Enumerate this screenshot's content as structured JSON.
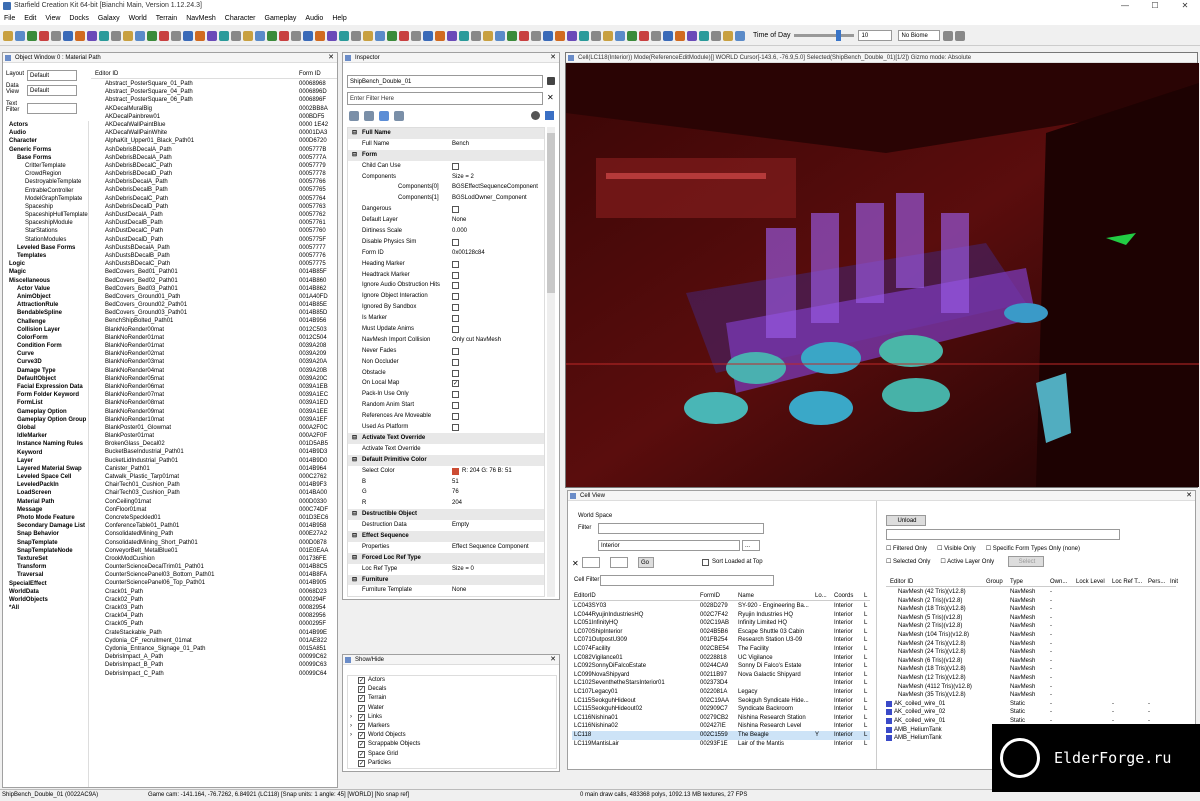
{
  "window_title": "Starfield Creation Kit 64-bit [Bianchi Main, Version 1.12.24.3]",
  "menu": [
    "File",
    "Edit",
    "View",
    "Docks",
    "Galaxy",
    "World",
    "Terrain",
    "NavMesh",
    "Character",
    "Gameplay",
    "Audio",
    "Help"
  ],
  "toolbar": {
    "time_of_day_label": "Time of Day",
    "time_value": "10",
    "biome_value": "No Biome"
  },
  "object_window": {
    "title": "Object Window 0 : Material Path",
    "layout_label": "Layout",
    "layout_value": "Default",
    "data_view_label": "Data View",
    "data_view_value": "Default",
    "text_filter_label": "Text Filter",
    "col_editor_id": "Editor ID",
    "col_form_id": "Form ID",
    "tree": [
      {
        "t": "Actors",
        "d": 0,
        "b": true
      },
      {
        "t": "Audio",
        "d": 0,
        "b": true
      },
      {
        "t": "Character",
        "d": 0,
        "b": true
      },
      {
        "t": "Generic Forms",
        "d": 0,
        "b": true
      },
      {
        "t": "Base Forms",
        "d": 1,
        "b": true
      },
      {
        "t": "CritterTemplate",
        "d": 2
      },
      {
        "t": "CrowdRegion",
        "d": 2
      },
      {
        "t": "DestroyableTemplate",
        "d": 2
      },
      {
        "t": "EntrableController",
        "d": 2
      },
      {
        "t": "ModelGraphTemplate",
        "d": 2
      },
      {
        "t": "Spaceship",
        "d": 2
      },
      {
        "t": "SpaceshipHullTemplate",
        "d": 2
      },
      {
        "t": "SpaceshipModule",
        "d": 2
      },
      {
        "t": "StarStations",
        "d": 2
      },
      {
        "t": "StationModules",
        "d": 2
      },
      {
        "t": "Leveled Base Forms",
        "d": 1,
        "b": true
      },
      {
        "t": "Templates",
        "d": 1,
        "b": true
      },
      {
        "t": "Logic",
        "d": 0,
        "b": true
      },
      {
        "t": "Magic",
        "d": 0,
        "b": true
      },
      {
        "t": "Miscellaneous",
        "d": 0,
        "b": true
      },
      {
        "t": "Actor Value",
        "d": 1,
        "b": true
      },
      {
        "t": "AnimObject",
        "d": 1,
        "b": true
      },
      {
        "t": "AttractionRule",
        "d": 1,
        "b": true
      },
      {
        "t": "BendableSpline",
        "d": 1,
        "b": true
      },
      {
        "t": "Challenge",
        "d": 1,
        "b": true
      },
      {
        "t": "Collision Layer",
        "d": 1,
        "b": true
      },
      {
        "t": "ColorForm",
        "d": 1,
        "b": true
      },
      {
        "t": "Condition Form",
        "d": 1,
        "b": true
      },
      {
        "t": "Curve",
        "d": 1,
        "b": true
      },
      {
        "t": "Curve3D",
        "d": 1,
        "b": true
      },
      {
        "t": "Damage Type",
        "d": 1,
        "b": true
      },
      {
        "t": "DefaultObject",
        "d": 1,
        "b": true
      },
      {
        "t": "Facial Expression Data",
        "d": 1,
        "b": true
      },
      {
        "t": "Form Folder Keyword",
        "d": 1,
        "b": true
      },
      {
        "t": "FormList",
        "d": 1,
        "b": true
      },
      {
        "t": "Gameplay Option",
        "d": 1,
        "b": true
      },
      {
        "t": "Gameplay Option Group",
        "d": 1,
        "b": true
      },
      {
        "t": "Global",
        "d": 1,
        "b": true
      },
      {
        "t": "IdleMarker",
        "d": 1,
        "b": true
      },
      {
        "t": "Instance Naming Rules",
        "d": 1,
        "b": true
      },
      {
        "t": "Keyword",
        "d": 1,
        "b": true
      },
      {
        "t": "Layer",
        "d": 1,
        "b": true
      },
      {
        "t": "Layered Material Swap",
        "d": 1,
        "b": true
      },
      {
        "t": "Leveled Space Cell",
        "d": 1,
        "b": true
      },
      {
        "t": "LeveledPackIn",
        "d": 1,
        "b": true
      },
      {
        "t": "LoadScreen",
        "d": 1,
        "b": true
      },
      {
        "t": "Material Path",
        "d": 1,
        "b": true
      },
      {
        "t": "Message",
        "d": 1,
        "b": true
      },
      {
        "t": "Photo Mode Feature",
        "d": 1,
        "b": true
      },
      {
        "t": "Secondary Damage List",
        "d": 1,
        "b": true
      },
      {
        "t": "Snap Behavior",
        "d": 1,
        "b": true
      },
      {
        "t": "SnapTemplate",
        "d": 1,
        "b": true
      },
      {
        "t": "SnapTemplateNode",
        "d": 1,
        "b": true
      },
      {
        "t": "TextureSet",
        "d": 1,
        "b": true
      },
      {
        "t": "Transform",
        "d": 1,
        "b": true
      },
      {
        "t": "Traversal",
        "d": 1,
        "b": true
      },
      {
        "t": "SpecialEffect",
        "d": 0,
        "b": true
      },
      {
        "t": "WorldData",
        "d": 0,
        "b": true
      },
      {
        "t": "WorldObjects",
        "d": 0,
        "b": true
      },
      {
        "t": "*All",
        "d": 0,
        "b": true
      }
    ],
    "items": [
      [
        "Abstract_PosterSquare_01_Path",
        "00068968"
      ],
      [
        "Abstract_PosterSquare_04_Path",
        "0006896D"
      ],
      [
        "Abstract_PosterSquare_06_Path",
        "0006896F"
      ],
      [
        "AKDecalMuralBig",
        "0002BB8A"
      ],
      [
        "AKDecalPainbrew01",
        "000BDF5"
      ],
      [
        "AKDecalWallPaintBlue",
        "0000 1E42"
      ],
      [
        "AKDecalWallPainWhite",
        "00001DA3"
      ],
      [
        "AlphaKit_Upper01_Black_Path01",
        "000D6720"
      ],
      [
        "AshDebrisBDecalA_Path",
        "0005777B"
      ],
      [
        "AshDebrisBDecalA_Path",
        "0005777A"
      ],
      [
        "AshDebrisBDecalC_Path",
        "00057779"
      ],
      [
        "AshDebrisBDecalD_Path",
        "00057778"
      ],
      [
        "AshDebrisDecalA_Path",
        "00057766"
      ],
      [
        "AshDebrisDecalB_Path",
        "00057765"
      ],
      [
        "AshDebrisDecalC_Path",
        "00057764"
      ],
      [
        "AshDebrisDecalD_Path",
        "00057763"
      ],
      [
        "AshDustDecalA_Path",
        "00057762"
      ],
      [
        "AshDustDecalB_Path",
        "00057761"
      ],
      [
        "AshDustDecalC_Path",
        "00057760"
      ],
      [
        "AshDustDecalD_Path",
        "0005775F"
      ],
      [
        "AshDustsBDecalA_Path",
        "00057777"
      ],
      [
        "AshDustsBDecalB_Path",
        "00057776"
      ],
      [
        "AshDustsBDecalC_Path",
        "00057775"
      ],
      [
        "BedCovers_Bed01_Path01",
        "0014B85F"
      ],
      [
        "BedCovers_Bed02_Path01",
        "0014B860"
      ],
      [
        "BedCovers_Bed03_Path01",
        "0014B862"
      ],
      [
        "BedCovers_Ground01_Path",
        "001A40FD"
      ],
      [
        "BedCovers_Ground02_Path01",
        "0014B85E"
      ],
      [
        "BedCovers_Ground03_Path01",
        "0014B85D"
      ],
      [
        "BenchShipBolted_Path01",
        "0014B956"
      ],
      [
        "BlankNoRender00mat",
        "0012C503"
      ],
      [
        "BlankNoRender01mat",
        "0012C504"
      ],
      [
        "BlankNoRender01mat",
        "0039A208"
      ],
      [
        "BlankNoRender02mat",
        "0039A209"
      ],
      [
        "BlankNoRender03mat",
        "0039A20A"
      ],
      [
        "BlankNoRender04mat",
        "0039A20B"
      ],
      [
        "BlankNoRender05mat",
        "0039A20C"
      ],
      [
        "BlankNoRender06mat",
        "0039A1EB"
      ],
      [
        "BlankNoRender07mat",
        "0039A1EC"
      ],
      [
        "BlankNoRender08mat",
        "0039A1ED"
      ],
      [
        "BlankNoRender09mat",
        "0039A1EE"
      ],
      [
        "BlankNoRender10mat",
        "0039A1EF"
      ],
      [
        "BlankPoster01_Glowmat",
        "000A2F0C"
      ],
      [
        "BlankPoster01mat",
        "000A2F0F"
      ],
      [
        "BrokenGlass_Decal02",
        "001D5AB5"
      ],
      [
        "BucketBaseIndustrial_Path01",
        "0014B9D3"
      ],
      [
        "BucketLidIndustrial_Path01",
        "0014B9D0"
      ],
      [
        "Canister_Path01",
        "0014B964"
      ],
      [
        "Catwalk_Plastic_Tarp01mat",
        "000C2762"
      ],
      [
        "ChairTech01_Cushion_Path",
        "0014B9F3"
      ],
      [
        "ChairTech03_Cushion_Path",
        "0014BA00"
      ],
      [
        "ConCeiling01mat",
        "000D0330"
      ],
      [
        "ConFloor01mat",
        "000C74DF"
      ],
      [
        "ConcreteSpeckled01",
        "001D3EC6"
      ],
      [
        "ConferenceTable01_Path01",
        "0014B958"
      ],
      [
        "ConsolidatedMining_Path",
        "000E27A2"
      ],
      [
        "ConsolidatedMining_Short_Path01",
        "000D0878"
      ],
      [
        "ConveyorBelt_MetalBlue01",
        "001E0EAA"
      ],
      [
        "CrookModCushion",
        "001736FE"
      ],
      [
        "CounterScienceDecalTrim01_Path01",
        "0014B8C5"
      ],
      [
        "CounterSciencePanel03_Bottom_Path01",
        "0014B8FA"
      ],
      [
        "CounterSciencePanel06_Top_Path01",
        "0014B905"
      ],
      [
        "Crack01_Path",
        "00068D23"
      ],
      [
        "Crack02_Path",
        "0000294F"
      ],
      [
        "Crack03_Path",
        "00082954"
      ],
      [
        "Crack04_Path",
        "00082956"
      ],
      [
        "Crack05_Path",
        "0000295F"
      ],
      [
        "CrateStackable_Path",
        "0014B99E"
      ],
      [
        "Cydonia_CF_recruitment_01mat",
        "001AE822"
      ],
      [
        "Cydonia_Entrance_Signage_01_Path",
        "0015A851"
      ],
      [
        "DebrisImpact_A_Path",
        "00099C62"
      ],
      [
        "DebrisImpact_B_Path",
        "00099C63"
      ],
      [
        "DebrisImpact_C_Path",
        "00099C64"
      ]
    ]
  },
  "inspector": {
    "title": "Inspector",
    "name_value": "ShipBench_Double_01",
    "filter_placeholder": "Enter Filter Here",
    "rows": [
      {
        "s": true,
        "k": "Full Name"
      },
      {
        "k": "Full Name",
        "v": "Bench"
      },
      {
        "s": true,
        "k": "Form"
      },
      {
        "k": "Child Can Use",
        "cb": "off"
      },
      {
        "k": "Components",
        "v": "Size = 2"
      },
      {
        "k": "Components[0]",
        "v": "BGSEffectSequenceComponent",
        "ind": true
      },
      {
        "k": "Components[1]",
        "v": "BGSLodOwner_Component",
        "ind": true
      },
      {
        "k": "Dangerous",
        "cb": "off"
      },
      {
        "k": "Default Layer",
        "v": "None"
      },
      {
        "k": "Dirtiness Scale",
        "v": "0.000"
      },
      {
        "k": "Disable Physics Sim",
        "cb": "off"
      },
      {
        "k": "Form ID",
        "v": "0x00128c84"
      },
      {
        "k": "Heading Marker",
        "cb": "off"
      },
      {
        "k": "Headtrack Marker",
        "cb": "off"
      },
      {
        "k": "Ignore Audio Obstruction Hits",
        "cb": "off"
      },
      {
        "k": "Ignore Object Interaction",
        "cb": "off"
      },
      {
        "k": "Ignored By Sandbox",
        "cb": "off"
      },
      {
        "k": "Is Marker",
        "cb": "off"
      },
      {
        "k": "Must Update Anims",
        "cb": "off"
      },
      {
        "k": "NavMesh Import Collision",
        "v": "Only cut NavMesh"
      },
      {
        "k": "Never Fades",
        "cb": "off"
      },
      {
        "k": "Non Occluder",
        "cb": "off"
      },
      {
        "k": "Obstacle",
        "cb": "off"
      },
      {
        "k": "On Local Map",
        "cb": "on"
      },
      {
        "k": "Pack-In Use Only",
        "cb": "off"
      },
      {
        "k": "Random Anim Start",
        "cb": "off"
      },
      {
        "k": "References Are Moveable",
        "cb": "off"
      },
      {
        "k": "Used As Platform",
        "cb": "off"
      },
      {
        "s": true,
        "k": "Activate Text Override"
      },
      {
        "k": "Activate Text Override"
      },
      {
        "s": true,
        "k": "Default Primitive Color"
      },
      {
        "k": "Select Color",
        "v": "R: 204 G: 76 B: 51",
        "sw": true
      },
      {
        "k": "B",
        "v": "51"
      },
      {
        "k": "G",
        "v": "76"
      },
      {
        "k": "R",
        "v": "204"
      },
      {
        "s": true,
        "k": "Destructible Object"
      },
      {
        "k": "Destruction Data",
        "v": "Empty"
      },
      {
        "s": true,
        "k": "Effect Sequence"
      },
      {
        "k": "Properties",
        "v": "Effect Sequence Component"
      },
      {
        "s": true,
        "k": "Forced Loc Ref Type"
      },
      {
        "k": "Loc Ref Type",
        "v": "Size = 0"
      },
      {
        "s": true,
        "k": "Furniture"
      },
      {
        "k": "Furniture Template",
        "v": "None"
      }
    ],
    "swatch_color": "#cc4c33"
  },
  "show_hide": {
    "title": "Show/Hide",
    "items": [
      {
        "t": "Actors",
        "e": false
      },
      {
        "t": "Decals",
        "e": false
      },
      {
        "t": "Terrain",
        "e": false
      },
      {
        "t": "Water",
        "e": false
      },
      {
        "t": "Links",
        "e": true
      },
      {
        "t": "Markers",
        "e": true
      },
      {
        "t": "World Objects",
        "e": true
      },
      {
        "t": "Scrappable Objects",
        "e": false
      },
      {
        "t": "Space Grid",
        "e": false
      },
      {
        "t": "Particles",
        "e": false
      }
    ]
  },
  "viewport": {
    "title": "Cell(LC118(Interior)) Mode(ReferenceEditModule)[] WORLD  Cursor[-143.6, -76.9,5.0]  Selected(ShipBench_Double_01)[1/2]) Gizmo mode: Absolute"
  },
  "cell_view": {
    "title": "Cell View",
    "world_space_label": "World Space",
    "filter_label": "Filter",
    "interior_value": "Interior",
    "go_label": "Go",
    "sort_label": "Sort Loaded at Top",
    "cell_filter_label": "Cell Filter",
    "cols": [
      "EditorID",
      "FormID",
      "Name",
      "Lo...",
      "Coords",
      "L"
    ],
    "rows": [
      [
        "LC043SY03",
        "0028D279",
        "SY-920 - Engineering Ba...",
        "",
        "Interior",
        "L"
      ],
      [
        "LC044RyujinIndustriesHQ",
        "002C7F42",
        "Ryujin Industries HQ",
        "",
        "Interior",
        "L"
      ],
      [
        "LC051InfinityHQ",
        "002C19AB",
        "Infinity Limited HQ",
        "",
        "Interior",
        "L"
      ],
      [
        "LC070ShipInterior",
        "0024B5B6",
        "Escape Shuttle 03 Cabin",
        "",
        "Interior",
        "L"
      ],
      [
        "LC071OutpostU309",
        "001FB254",
        "Research Station U3-09",
        "",
        "Interior",
        "L"
      ],
      [
        "LC074Facility",
        "002CBE54",
        "The Facility",
        "",
        "Interior",
        "L"
      ],
      [
        "LC082Vigilance01",
        "00228818",
        "UC Vigilance",
        "",
        "Interior",
        "L"
      ],
      [
        "LC092SonnyDiFalcoEstate",
        "00244CA9",
        "Sonny Di Falco's Estate",
        "",
        "Interior",
        "L"
      ],
      [
        "LC099NovaShipyard",
        "00211B97",
        "Nova Galactic Shipyard",
        "",
        "Interior",
        "L"
      ],
      [
        "LC102SeventhetheStarsInterior01",
        "002373D4",
        "",
        "",
        "Interior",
        "L"
      ],
      [
        "LC107Legacy01",
        "0022081A",
        "Legacy",
        "",
        "Interior",
        "L"
      ],
      [
        "LC115SeokguhHideout",
        "002C19AA",
        "Seokguh Syndicate Hide...",
        "",
        "Interior",
        "L"
      ],
      [
        "LC115SeokguhHideout02",
        "002909C7",
        "Syndicate Backroom",
        "",
        "Interior",
        "L"
      ],
      [
        "LC116Nishina01",
        "00279CB2",
        "Nishina Research Station",
        "",
        "Interior",
        "L"
      ],
      [
        "LC116Nishina02",
        "002427IE",
        "Nishina Research Level",
        "",
        "Interior",
        "L"
      ],
      [
        "LC118",
        "002C1559",
        "The Beagle",
        "Y",
        "Interior",
        "L"
      ],
      [
        "LC119MantisLair",
        "00293F1E",
        "Lair of the Mantis",
        "",
        "Interior",
        "L"
      ]
    ],
    "unload_label": "Unload",
    "filtered_only": "Filtered Only",
    "visible_only": "Visible Only",
    "specific_form": "Specific Form Types Only (none)",
    "selected_only": "Selected Only",
    "active_layer_only": "Active Layer Only",
    "select_label": "Select",
    "ref_cols": [
      "Editor ID",
      "Group",
      "Type",
      "Own...",
      "Lock Level",
      "Loc Ref T...",
      "Pers...",
      "Init"
    ],
    "refs": [
      [
        "NavMesh (42 Tris)(v12.8)",
        "",
        "NavMesh",
        "-"
      ],
      [
        "NavMesh (2 Tris)(v12.8)",
        "",
        "NavMesh",
        "-"
      ],
      [
        "NavMesh (18 Tris)(v12.8)",
        "",
        "NavMesh",
        "-"
      ],
      [
        "NavMesh (5 Tris)(v12.8)",
        "",
        "NavMesh",
        "-"
      ],
      [
        "NavMesh (2 Tris)(v12.8)",
        "",
        "NavMesh",
        "-"
      ],
      [
        "NavMesh (104 Tris)(v12.8)",
        "",
        "NavMesh",
        "-"
      ],
      [
        "NavMesh (24 Tris)(v12.8)",
        "",
        "NavMesh",
        "-"
      ],
      [
        "NavMesh (24 Tris)(v12.8)",
        "",
        "NavMesh",
        "-"
      ],
      [
        "NavMesh (6 Tris)(v12.8)",
        "",
        "NavMesh",
        "-"
      ],
      [
        "NavMesh (18 Tris)(v12.8)",
        "",
        "NavMesh",
        "-"
      ],
      [
        "NavMesh (12 Tris)(v12.8)",
        "",
        "NavMesh",
        "-"
      ],
      [
        "NavMesh (4112 Tris)(v12.8)",
        "",
        "NavMesh",
        "-"
      ],
      [
        "NavMesh (35 Tris)(v12.8)",
        "",
        "NavMesh",
        "-"
      ],
      [
        "AK_coiled_wire_01",
        "",
        "Static",
        "-"
      ],
      [
        "AK_coiled_wire_02",
        "",
        "Static",
        "-"
      ],
      [
        "AK_coiled_wire_01",
        "",
        "Static",
        "-"
      ],
      [
        "AMB_HeliumTank",
        "",
        "Static",
        "-"
      ],
      [
        "AMB_HeliumTank",
        "",
        "Static",
        "-"
      ]
    ]
  },
  "status": {
    "left": "ShipBench_Double_01 (0022AC9A)",
    "mid": "Game cam: -141.164, -76.7262, 6.84921 (LC118) [Snap units: 1 angle: 45] [WORLD] [No snap ref]",
    "right": "0 main draw calls, 483368 polys, 1092.13 MB textures, 27 FPS"
  },
  "watermark": "ElderForge.ru"
}
